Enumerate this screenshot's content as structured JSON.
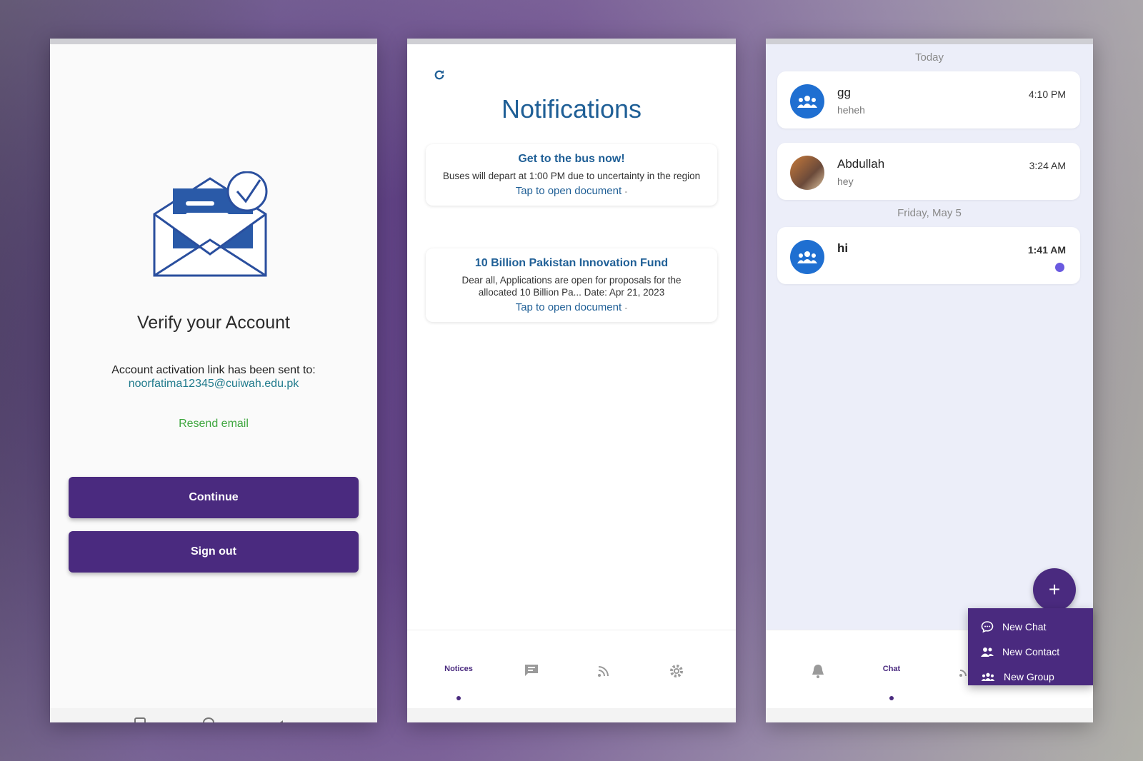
{
  "verify_screen": {
    "title": "Verify your Account",
    "info_text": "Account activation link has been sent to:",
    "email": "noorfatima12345@cuiwah.edu.pk",
    "resend_label": "Resend email",
    "continue_label": "Continue",
    "signout_label": "Sign out"
  },
  "notifications_screen": {
    "title": "Notifications",
    "notices": [
      {
        "title": "Get to the bus now!",
        "body": "Buses will depart at 1:00 PM due to uncertainty in the region",
        "link": "Tap to open document",
        "link_suffix": "-"
      },
      {
        "title": "10 Billion Pakistan Innovation Fund",
        "body": "Dear all, Applications are open for proposals for the allocated 10 Billion Pa...  Date: Apr 21, 2023",
        "link": "Tap to open document",
        "link_suffix": "-"
      }
    ],
    "bottom_nav": {
      "active_label": "Notices",
      "icons": [
        "chat-icon",
        "rss-icon",
        "settings-icon"
      ]
    }
  },
  "chat_screen": {
    "dates": [
      "Today",
      "Friday, May 5"
    ],
    "chats": [
      {
        "name": "gg",
        "message": "heheh",
        "time": "4:10 PM"
      },
      {
        "name": "Abdullah",
        "message": "hey",
        "time": "3:24 AM"
      },
      {
        "name": "hi",
        "message": "",
        "time": "1:41 AM"
      }
    ],
    "bottom_nav": {
      "active_label": "Chat",
      "icons": [
        "bell-icon",
        "rss-icon"
      ]
    },
    "fab_symbol": "+",
    "fab_menu": [
      {
        "label": "New Chat",
        "icon": "chat-bubble-icon"
      },
      {
        "label": "New Contact",
        "icon": "contact-icon"
      },
      {
        "label": "New Group",
        "icon": "group-icon"
      }
    ]
  },
  "colors": {
    "primary": "#4a2a7f",
    "notice_blue": "#1f5f96",
    "email_teal": "#1f7a8c",
    "resend_green": "#3ea63e",
    "avatar_blue": "#1f6fd1",
    "unread_dot": "#6a5ae0"
  }
}
